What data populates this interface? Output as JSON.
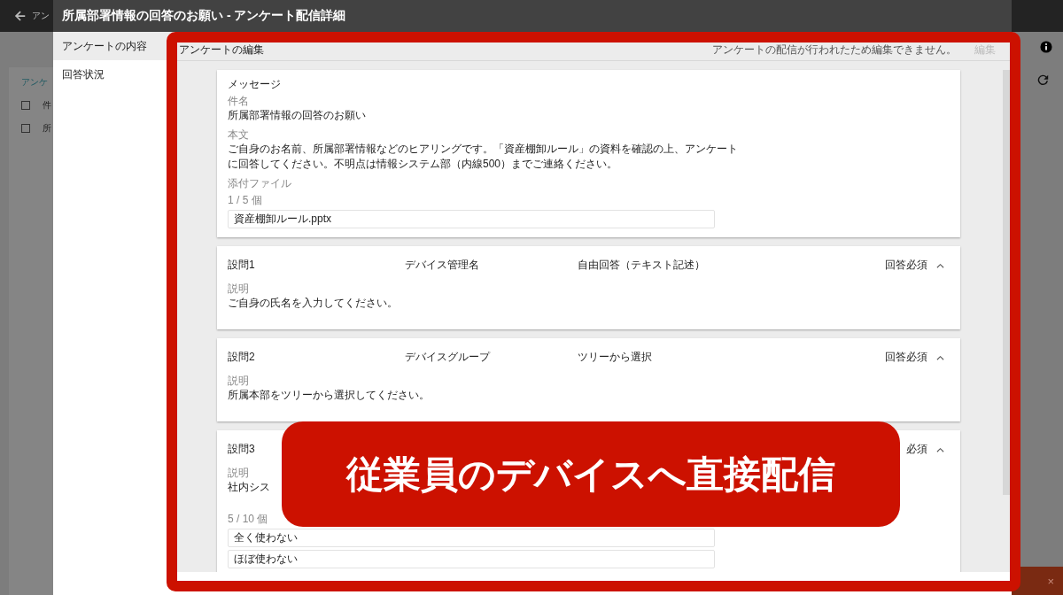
{
  "background_app": {
    "back_label": "アン",
    "tab_label": "アンケ",
    "header_row": {
      "label": "件",
      "checked": false
    },
    "body_row": {
      "label": "所",
      "checked": false
    },
    "snackbar_close": "×"
  },
  "dialog": {
    "title": "所属部署情報の回答のお願い - アンケート配信詳細",
    "nav": [
      {
        "label": "アンケートの内容",
        "selected": true
      },
      {
        "label": "回答状況",
        "selected": false
      }
    ]
  },
  "editor": {
    "title": "アンケートの編集",
    "notice": "アンケートの配信が行われたため編集できません。",
    "edit_button": {
      "label": "編集",
      "disabled": true
    }
  },
  "message": {
    "heading": "メッセージ",
    "fields": [
      {
        "label": "件名",
        "value": "所属部署情報の回答のお願い"
      },
      {
        "label": "本文",
        "value": "ご自身のお名前、所属部署情報などのヒアリングです。「資産棚卸ルール」の資料を確認の上、アンケートに回答してください。不明点は情報システム部（内線500）までご連絡ください。"
      }
    ],
    "attachments": {
      "label": "添付ファイル",
      "count": "1 / 5 個",
      "files": [
        "資産棚卸ルール.pptx"
      ]
    }
  },
  "questions": [
    {
      "number": "設問1",
      "name": "デバイス管理名",
      "type": "自由回答（テキスト記述）",
      "required": "回答必須",
      "expanded": true,
      "description_label": "説明",
      "description": "ご自身の氏名を入力してください。"
    },
    {
      "number": "設問2",
      "name": "デバイスグループ",
      "type": "ツリーから選択",
      "required": "回答必須",
      "expanded": true,
      "description_label": "説明",
      "description": "所属本部をツリーから選択してください。"
    },
    {
      "number": "設問3",
      "required": "必須",
      "expanded": true,
      "description_label": "説明",
      "description": "社内シス",
      "choices_count": "5 / 10 個",
      "choices": [
        "全く使わない",
        "ほぼ使わない"
      ]
    }
  ],
  "callout": "従業員のデバイスへ直接配信"
}
